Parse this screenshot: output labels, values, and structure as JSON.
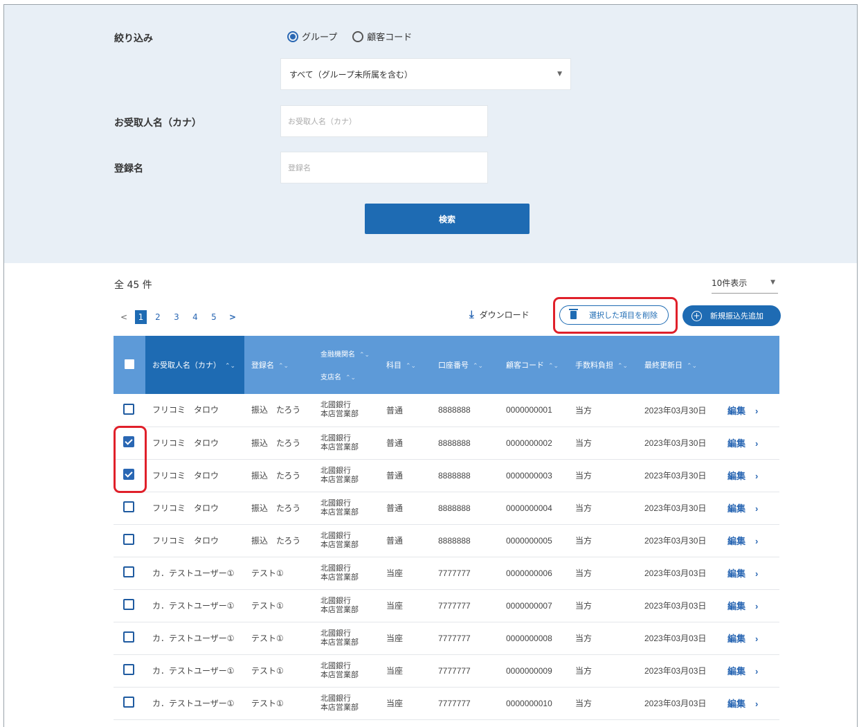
{
  "filter": {
    "narrow_label": "絞り込み",
    "radio_group": "グループ",
    "radio_customer": "顧客コード",
    "group_select_value": "すべて（グループ未所属を含む）",
    "recipient_label": "お受取人名（カナ）",
    "recipient_placeholder": "お受取人名（カナ）",
    "regname_label": "登録名",
    "regname_placeholder": "登録名",
    "search_button": "検索"
  },
  "results": {
    "count": "全 45 件",
    "per_page": "10件表示",
    "pages": [
      "1",
      "2",
      "3",
      "4",
      "5"
    ],
    "current_page": "1",
    "download": "ダウンロード",
    "delete_selected": "選択した項目を削除",
    "add_new": "新規振込先追加"
  },
  "table": {
    "headers": {
      "recipient": "お受取人名（カナ）",
      "regname": "登録名",
      "bank": "金融機関名",
      "branch": "支店名",
      "account_type": "科目",
      "account_no": "口座番号",
      "customer_code": "顧客コード",
      "fee": "手数料負担",
      "updated": "最終更新日"
    },
    "edit_label": "編集",
    "rows": [
      {
        "checked": false,
        "name": "フリコミ　タロウ",
        "reg": "振込　たろう",
        "bank": "北國銀行",
        "branch": "本店営業部",
        "type": "普通",
        "acct": "8888888",
        "code": "0000000001",
        "fee": "当方",
        "date": "2023年03月30日"
      },
      {
        "checked": true,
        "name": "フリコミ　タロウ",
        "reg": "振込　たろう",
        "bank": "北國銀行",
        "branch": "本店営業部",
        "type": "普通",
        "acct": "8888888",
        "code": "0000000002",
        "fee": "当方",
        "date": "2023年03月30日"
      },
      {
        "checked": true,
        "name": "フリコミ　タロウ",
        "reg": "振込　たろう",
        "bank": "北國銀行",
        "branch": "本店営業部",
        "type": "普通",
        "acct": "8888888",
        "code": "0000000003",
        "fee": "当方",
        "date": "2023年03月30日"
      },
      {
        "checked": false,
        "name": "フリコミ　タロウ",
        "reg": "振込　たろう",
        "bank": "北國銀行",
        "branch": "本店営業部",
        "type": "普通",
        "acct": "8888888",
        "code": "0000000004",
        "fee": "当方",
        "date": "2023年03月30日"
      },
      {
        "checked": false,
        "name": "フリコミ　タロウ",
        "reg": "振込　たろう",
        "bank": "北國銀行",
        "branch": "本店営業部",
        "type": "普通",
        "acct": "8888888",
        "code": "0000000005",
        "fee": "当方",
        "date": "2023年03月30日"
      },
      {
        "checked": false,
        "name": "カ．テストユーザー①",
        "reg": "テスト①",
        "bank": "北國銀行",
        "branch": "本店営業部",
        "type": "当座",
        "acct": "7777777",
        "code": "0000000006",
        "fee": "当方",
        "date": "2023年03月03日"
      },
      {
        "checked": false,
        "name": "カ．テストユーザー①",
        "reg": "テスト①",
        "bank": "北國銀行",
        "branch": "本店営業部",
        "type": "当座",
        "acct": "7777777",
        "code": "0000000007",
        "fee": "当方",
        "date": "2023年03月03日"
      },
      {
        "checked": false,
        "name": "カ．テストユーザー①",
        "reg": "テスト①",
        "bank": "北國銀行",
        "branch": "本店営業部",
        "type": "当座",
        "acct": "7777777",
        "code": "0000000008",
        "fee": "当方",
        "date": "2023年03月03日"
      },
      {
        "checked": false,
        "name": "カ．テストユーザー①",
        "reg": "テスト①",
        "bank": "北國銀行",
        "branch": "本店営業部",
        "type": "当座",
        "acct": "7777777",
        "code": "0000000009",
        "fee": "当方",
        "date": "2023年03月03日"
      },
      {
        "checked": false,
        "name": "カ．テストユーザー①",
        "reg": "テスト①",
        "bank": "北國銀行",
        "branch": "本店営業部",
        "type": "当座",
        "acct": "7777777",
        "code": "0000000010",
        "fee": "当方",
        "date": "2023年03月03日"
      }
    ]
  },
  "colors": {
    "primary": "#1e6bb3",
    "header": "#5d9ad8",
    "filter_bg": "#e8eff6",
    "highlight": "#e0202a"
  }
}
